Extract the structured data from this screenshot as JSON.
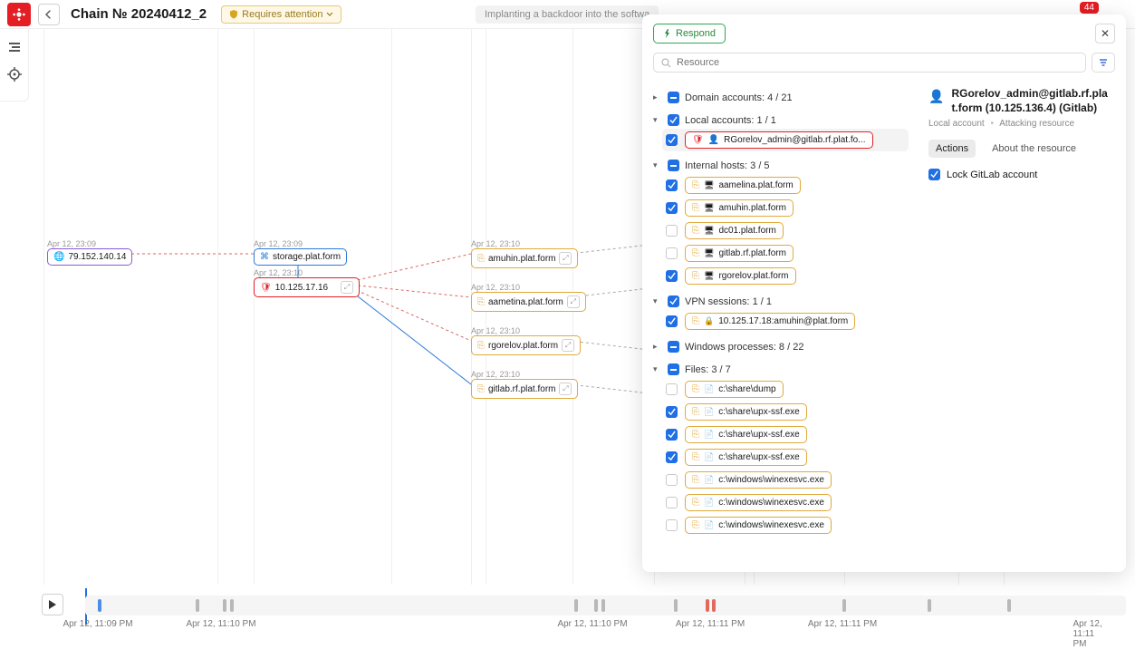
{
  "header": {
    "title": "Chain № 20240412_2",
    "status": "Requires attention",
    "context": "Implanting a backdoor into the softwa",
    "badge": "44"
  },
  "graph": {
    "n1": {
      "ts": "Apr 12, 23:09",
      "label": "79.152.140.14"
    },
    "n2": {
      "ts": "Apr 12, 23:09",
      "label": "storage.plat.form"
    },
    "n3": {
      "ts": "Apr 12, 23:10",
      "label": "10.125.17.16"
    },
    "n4": {
      "ts": "Apr 12, 23:10",
      "label": "amuhin.plat.form"
    },
    "n5": {
      "ts": "Apr 12, 23:10",
      "label": "aametina.plat.form"
    },
    "n6": {
      "ts": "Apr 12, 23:10",
      "label": "rgorelov.plat.form"
    },
    "n7": {
      "ts": "Apr 12, 23:10",
      "label": "gitlab.rf.plat.form"
    }
  },
  "panel": {
    "respond": "Respond",
    "search_placeholder": "Resource",
    "groups": {
      "domain": {
        "label": "Domain accounts: 4 / 21"
      },
      "local": {
        "label": "Local accounts: 1 / 1",
        "items": [
          {
            "label": "RGorelov_admin@gitlab.rf.plat.fo...",
            "color": "red",
            "checked": true,
            "selected": true
          }
        ]
      },
      "hosts": {
        "label": "Internal hosts: 3 / 5",
        "items": [
          {
            "label": "aamelina.plat.form",
            "checked": true
          },
          {
            "label": "amuhin.plat.form",
            "checked": true
          },
          {
            "label": "dc01.plat.form",
            "checked": false
          },
          {
            "label": "gitlab.rf.plat.form",
            "checked": false
          },
          {
            "label": "rgorelov.plat.form",
            "checked": true
          }
        ]
      },
      "vpn": {
        "label": "VPN sessions: 1 / 1",
        "items": [
          {
            "label": "10.125.17.18:amuhin@plat.form",
            "checked": true
          }
        ]
      },
      "winproc": {
        "label": "Windows processes: 8 / 22"
      },
      "files": {
        "label": "Files: 3 / 7",
        "items": [
          {
            "label": "c:\\share\\dump",
            "checked": false
          },
          {
            "label": "c:\\share\\upx-ssf.exe",
            "checked": true
          },
          {
            "label": "c:\\share\\upx-ssf.exe",
            "checked": true
          },
          {
            "label": "c:\\share\\upx-ssf.exe",
            "checked": true
          },
          {
            "label": "c:\\windows\\winexesvc.exe",
            "checked": false
          },
          {
            "label": "c:\\windows\\winexesvc.exe",
            "checked": false
          },
          {
            "label": "c:\\windows\\winexesvc.exe",
            "checked": false
          }
        ]
      }
    },
    "detail": {
      "title": "RGorelov_admin@gitlab.rf.plat.form (10.125.136.4) (Gitlab)",
      "sub_a": "Local account",
      "sub_b": "Attacking resource",
      "tab_actions": "Actions",
      "tab_about": "About the resource",
      "action_lock": "Lock GitLab account"
    }
  },
  "timeline": {
    "labels": {
      "l1": "Apr 12, 11:09 PM",
      "l2": "Apr 12, 11:10 PM",
      "l3": "Apr 12, 11:10 PM",
      "l4": "Apr 12, 11:11 PM",
      "l5": "Apr 12, 11:11 PM",
      "l6": "Apr 12, 11:11 PM"
    }
  }
}
